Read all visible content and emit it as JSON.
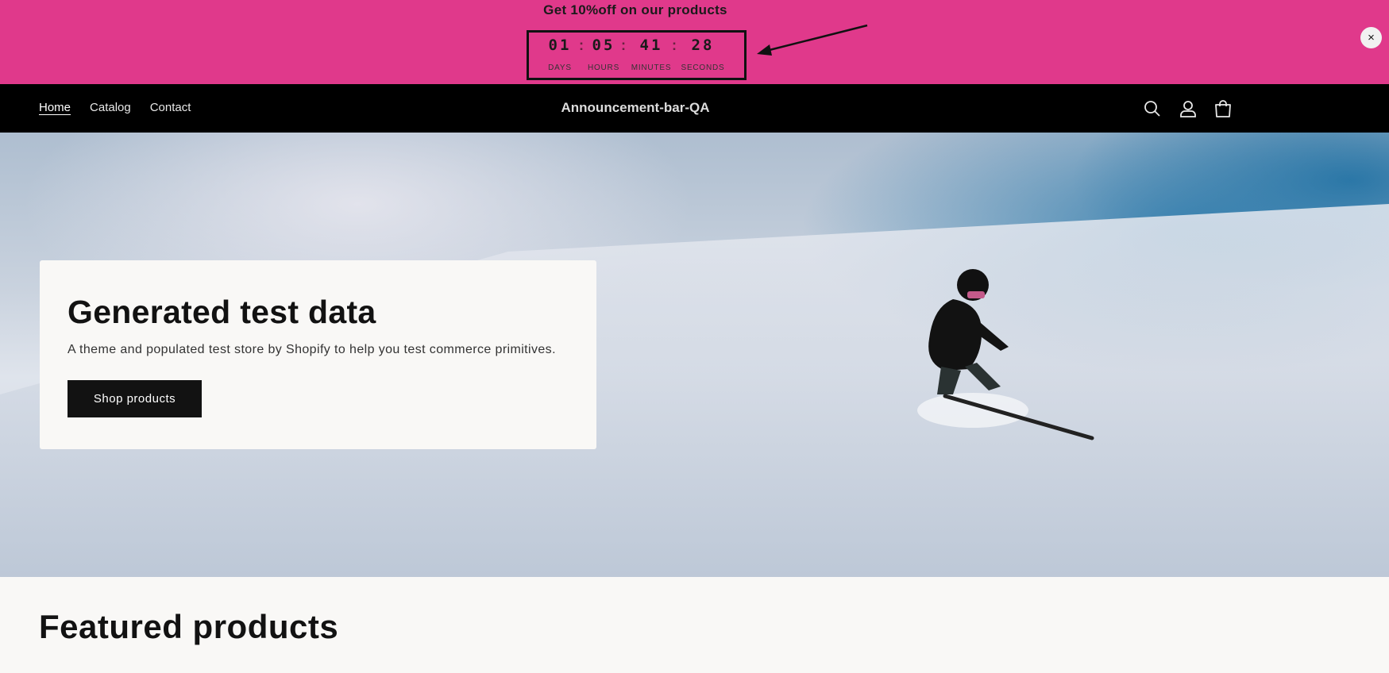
{
  "announcement": {
    "title": "Get 10%off on our products",
    "countdown": {
      "days": "01",
      "hours": "05",
      "minutes": "41",
      "seconds": "28",
      "days_label": "DAYS",
      "hours_label": "HOURS",
      "minutes_label": "MINUTES",
      "seconds_label": "SECONDS",
      "separator": ":"
    },
    "close_label": "×",
    "bg_color": "#e0398b"
  },
  "header": {
    "nav": [
      "Home",
      "Catalog",
      "Contact"
    ],
    "active_nav": "Home",
    "brand": "Announcement-bar-QA",
    "icons": [
      "search-icon",
      "account-icon",
      "cart-icon"
    ]
  },
  "hero": {
    "title": "Generated test data",
    "subtitle": "A theme and populated test store by Shopify to help you test commerce primitives.",
    "button_label": "Shop products"
  },
  "featured": {
    "title": "Featured products"
  }
}
